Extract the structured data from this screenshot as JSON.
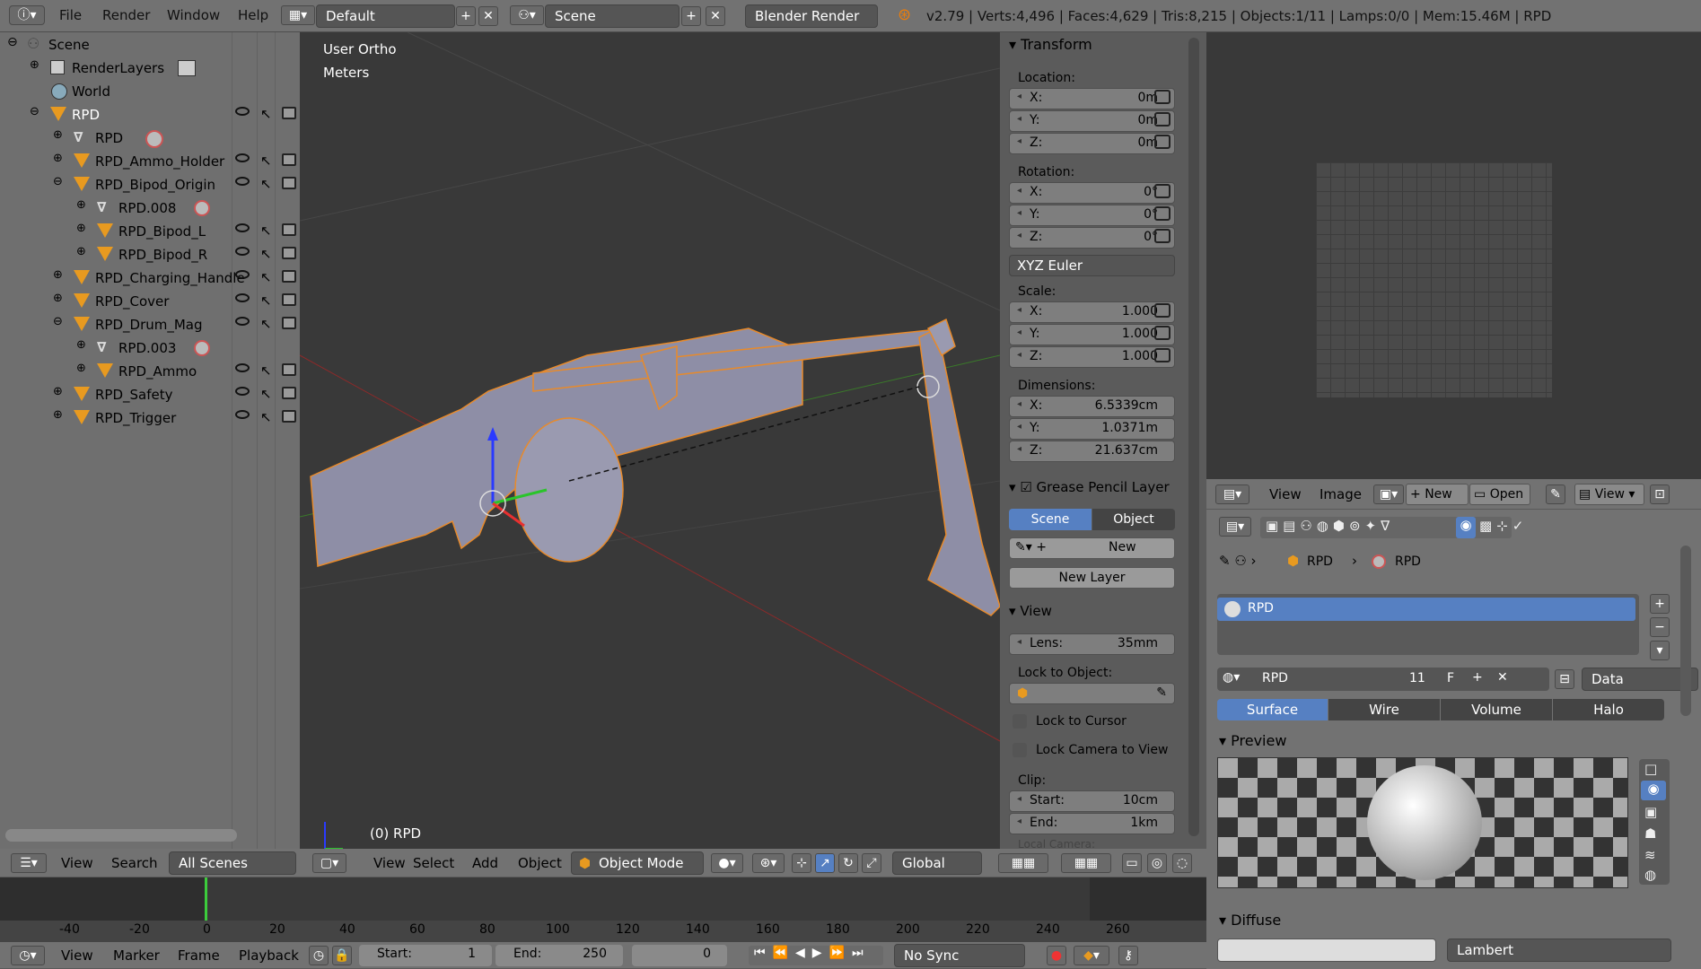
{
  "topbar": {
    "menus": [
      "File",
      "Render",
      "Window",
      "Help"
    ],
    "layout": "Default",
    "scene": "Scene",
    "engine": "Blender Render",
    "stats": "v2.79 | Verts:4,496 | Faces:4,629 | Tris:8,215 | Objects:1/11 | Lamps:0/0 | Mem:15.46M | RPD"
  },
  "outliner": {
    "items": [
      "Scene",
      "RenderLayers",
      "World",
      "RPD",
      "RPD",
      "RPD_Ammo_Holder",
      "RPD_Bipod_Origin",
      "RPD.008",
      "RPD_Bipod_L",
      "RPD_Bipod_R",
      "RPD_Charging_Handle",
      "RPD_Cover",
      "RPD_Drum_Mag",
      "RPD.003",
      "RPD_Ammo",
      "RPD_Safety",
      "RPD_Trigger"
    ],
    "footer": {
      "view": "View",
      "search": "Search",
      "filter": "All Scenes"
    }
  },
  "viewport": {
    "mode_text": "User Ortho",
    "units_text": "Meters",
    "object_text": "(0) RPD",
    "menus": [
      "View",
      "Select",
      "Add",
      "Object"
    ],
    "mode": "Object Mode",
    "orientation": "Global"
  },
  "npanel": {
    "transform": "Transform",
    "location": "Location:",
    "loc": [
      {
        "k": "X:",
        "v": "0m"
      },
      {
        "k": "Y:",
        "v": "0m"
      },
      {
        "k": "Z:",
        "v": "0m"
      }
    ],
    "rotation": "Rotation:",
    "rot": [
      {
        "k": "X:",
        "v": "0°"
      },
      {
        "k": "Y:",
        "v": "0°"
      },
      {
        "k": "Z:",
        "v": "0°"
      }
    ],
    "rot_mode": "XYZ Euler",
    "scale": "Scale:",
    "scl": [
      {
        "k": "X:",
        "v": "1.000"
      },
      {
        "k": "Y:",
        "v": "1.000"
      },
      {
        "k": "Z:",
        "v": "1.000"
      }
    ],
    "dimensions": "Dimensions:",
    "dim": [
      {
        "k": "X:",
        "v": "6.5339cm"
      },
      {
        "k": "Y:",
        "v": "1.0371m"
      },
      {
        "k": "Z:",
        "v": "21.637cm"
      }
    ],
    "grease": "Grease Pencil Layer",
    "gp_scene": "Scene",
    "gp_object": "Object",
    "gp_new": "New",
    "gp_newlayer": "New Layer",
    "view": "View",
    "lens_k": "Lens:",
    "lens_v": "35mm",
    "lock_obj": "Lock to Object:",
    "lock_cursor": "Lock to Cursor",
    "lock_camera": "Lock Camera to View",
    "clip": "Clip:",
    "clip_start_k": "Start:",
    "clip_start_v": "10cm",
    "clip_end_k": "End:",
    "clip_end_v": "1km",
    "local_camera": "Local Camera:"
  },
  "uvedit": {
    "menus": [
      "View",
      "Image"
    ],
    "new": "New",
    "open": "Open",
    "view2": "View"
  },
  "props": {
    "crumb1": "RPD",
    "crumb2": "RPD",
    "slot": "RPD",
    "mat_name": "RPD",
    "users": "11",
    "fake": "F",
    "link": "Data",
    "tabs": [
      "Surface",
      "Wire",
      "Volume",
      "Halo"
    ],
    "preview": "Preview",
    "diffuse": "Diffuse",
    "shader": "Lambert"
  },
  "timeline": {
    "ticks": [
      "-40",
      "-20",
      "0",
      "20",
      "40",
      "60",
      "80",
      "100",
      "120",
      "140",
      "160",
      "180",
      "200",
      "220",
      "240",
      "260"
    ],
    "menus": [
      "View",
      "Marker",
      "Frame",
      "Playback"
    ],
    "start_k": "Start:",
    "start_v": "1",
    "end_k": "End:",
    "end_v": "250",
    "current": "0",
    "sync": "No Sync"
  }
}
